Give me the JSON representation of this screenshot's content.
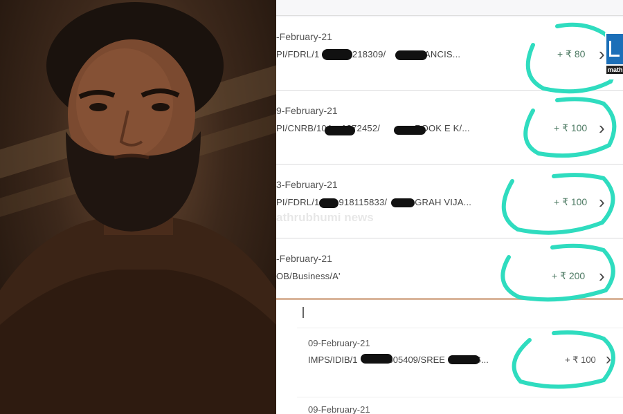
{
  "watermark": "athrubhumi news",
  "logo_text": "math",
  "transactions": [
    {
      "date": "-February-21",
      "ref_prefix": "PI/FDRL/1",
      "ref_mid": "2218309/",
      "ref_tail": "FRANCIS...",
      "amount": "+ ₹ 80"
    },
    {
      "date": "9-February-21",
      "ref_prefix": "PI/CNRB/104",
      "ref_mid": "1272452/",
      "ref_tail": "ROOK E K/...",
      "amount": "+ ₹ 100"
    },
    {
      "date": "3-February-21",
      "ref_prefix": "PI/FDRL/1",
      "ref_mid": "918115833/",
      "ref_tail": "GRAH VIJA...",
      "amount": "+ ₹ 100"
    },
    {
      "date": "-February-21",
      "ref_prefix": "OB/Business/A'",
      "ref_mid": "",
      "ref_tail": "",
      "amount": "+ ₹ 200"
    }
  ],
  "bottom_transactions": [
    {
      "date": "09-February-21",
      "ref_prefix": "IMPS/IDIB/1",
      "ref_mid": "605409/SREE",
      "ref_tail": "G...",
      "amount": "+ ₹ 100"
    },
    {
      "date": "09-February-21"
    }
  ],
  "colors": {
    "annotation": "#2fdcbf",
    "amount_green": "#4d7a63",
    "redaction": "#111111"
  }
}
